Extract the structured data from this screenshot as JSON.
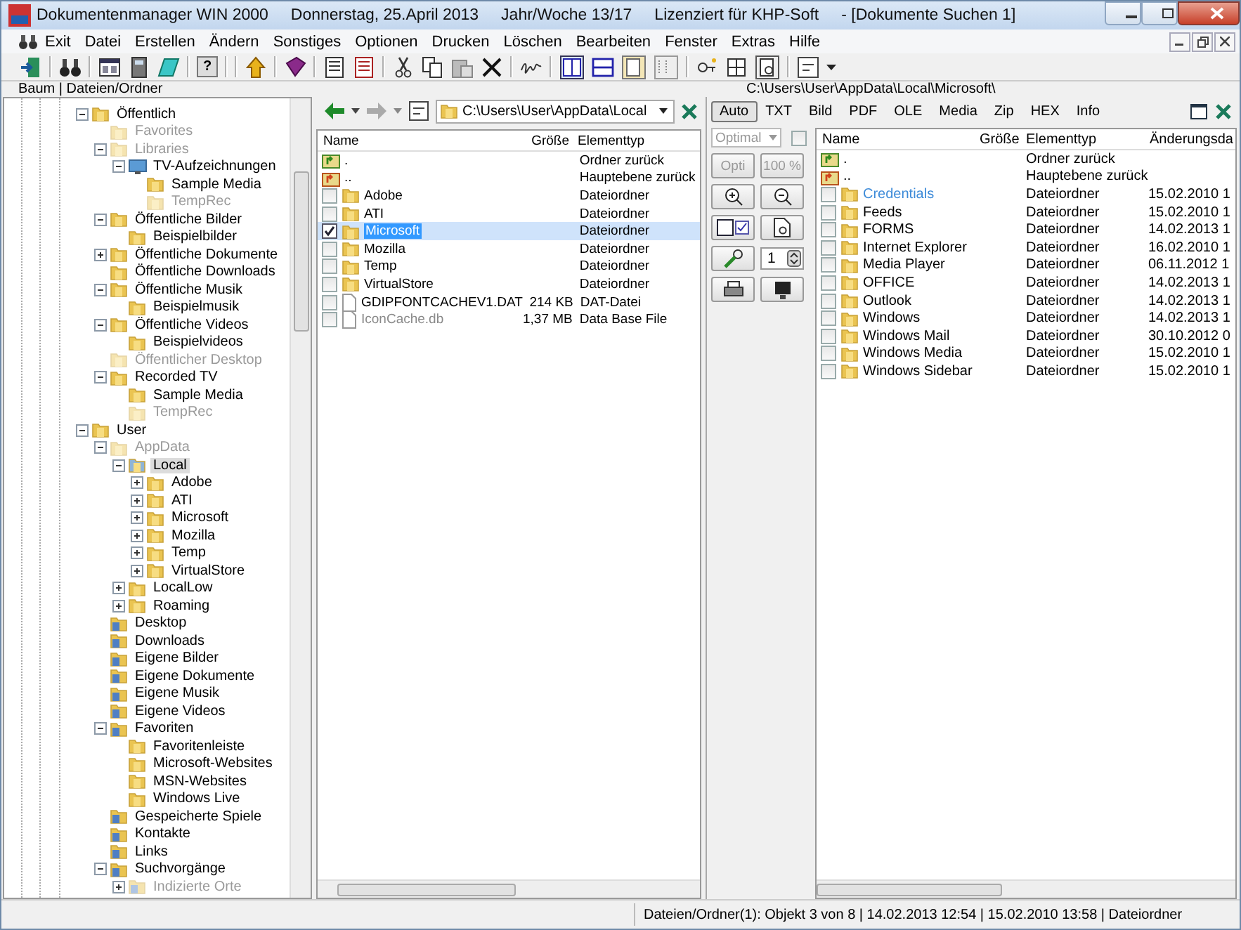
{
  "window": {
    "title_parts": [
      "Dokumentenmanager WIN 2000",
      "Donnerstag, 25.April 2013",
      "Jahr/Woche 13/17",
      "Lizenziert für KHP-Soft",
      "- [Dokumente Suchen 1]"
    ]
  },
  "menu": [
    "Exit",
    "Datei",
    "Erstellen",
    "Ändern",
    "Sonstiges",
    "Optionen",
    "Drucken",
    "Löschen",
    "Bearbeiten",
    "Fenster",
    "Extras",
    "Hilfe"
  ],
  "toolbar": {
    "help_label": "?"
  },
  "panel_label": "Baum | Dateien/Ordner",
  "tree": [
    {
      "label": "Öffentlich",
      "kind": "folder",
      "expanded": true,
      "dimmed": false,
      "selected": false,
      "children": [
        {
          "label": "Favorites",
          "kind": "folder",
          "dimmed": true,
          "selected": false
        },
        {
          "label": "Libraries",
          "kind": "folder",
          "expanded": true,
          "dimmed": true,
          "selected": false,
          "children": [
            {
              "label": "TV-Aufzeichnungen",
              "kind": "screen",
              "expanded": true,
              "dimmed": false,
              "selected": false,
              "children": [
                {
                  "label": "Sample Media",
                  "kind": "folder",
                  "dimmed": false,
                  "selected": false
                },
                {
                  "label": "TempRec",
                  "kind": "folder",
                  "dimmed": true,
                  "selected": false
                }
              ]
            }
          ]
        },
        {
          "label": "Öffentliche Bilder",
          "kind": "folder",
          "expanded": true,
          "dimmed": false,
          "selected": false,
          "children": [
            {
              "label": "Beispielbilder",
              "kind": "folder",
              "dimmed": false,
              "selected": false
            }
          ]
        },
        {
          "label": "Öffentliche Dokumente",
          "kind": "folder",
          "expanded": false,
          "dimmed": false,
          "selected": false
        },
        {
          "label": "Öffentliche Downloads",
          "kind": "folder",
          "dimmed": false,
          "selected": false
        },
        {
          "label": "Öffentliche Musik",
          "kind": "folder",
          "expanded": true,
          "dimmed": false,
          "selected": false,
          "children": [
            {
              "label": "Beispielmusik",
              "kind": "folder",
              "dimmed": false,
              "selected": false
            }
          ]
        },
        {
          "label": "Öffentliche Videos",
          "kind": "folder",
          "expanded": true,
          "dimmed": false,
          "selected": false,
          "children": [
            {
              "label": "Beispielvideos",
              "kind": "folder",
              "dimmed": false,
              "selected": false
            }
          ]
        },
        {
          "label": "Öffentlicher Desktop",
          "kind": "folder",
          "dimmed": true,
          "selected": false
        },
        {
          "label": "Recorded TV",
          "kind": "folder",
          "expanded": true,
          "dimmed": false,
          "selected": false,
          "children": [
            {
              "label": "Sample Media",
              "kind": "folder",
              "dimmed": false,
              "selected": false
            },
            {
              "label": "TempRec",
              "kind": "folder",
              "dimmed": true,
              "selected": false
            }
          ]
        }
      ]
    },
    {
      "label": "User",
      "kind": "folder",
      "expanded": true,
      "dimmed": false,
      "selected": false,
      "children": [
        {
          "label": "AppData",
          "kind": "folder",
          "expanded": true,
          "dimmed": true,
          "selected": false,
          "children": [
            {
              "label": "Local",
              "kind": "folder",
              "expanded": true,
              "dimmed": false,
              "selected": true,
              "children": [
                {
                  "label": "Adobe",
                  "kind": "folder",
                  "expanded": false,
                  "dimmed": false,
                  "selected": false
                },
                {
                  "label": "ATI",
                  "kind": "folder",
                  "expanded": false,
                  "dimmed": false,
                  "selected": false
                },
                {
                  "label": "Microsoft",
                  "kind": "folder",
                  "expanded": false,
                  "dimmed": false,
                  "selected": false
                },
                {
                  "label": "Mozilla",
                  "kind": "folder",
                  "expanded": false,
                  "dimmed": false,
                  "selected": false
                },
                {
                  "label": "Temp",
                  "kind": "folder",
                  "expanded": false,
                  "dimmed": false,
                  "selected": false
                },
                {
                  "label": "VirtualStore",
                  "kind": "folder",
                  "expanded": false,
                  "dimmed": false,
                  "selected": false
                }
              ]
            },
            {
              "label": "LocalLow",
              "kind": "folder",
              "expanded": false,
              "dimmed": false,
              "selected": false
            },
            {
              "label": "Roaming",
              "kind": "folder",
              "expanded": false,
              "dimmed": false,
              "selected": false
            }
          ]
        },
        {
          "label": "Desktop",
          "kind": "special",
          "dimmed": false,
          "selected": false
        },
        {
          "label": "Downloads",
          "kind": "special",
          "dimmed": false,
          "selected": false
        },
        {
          "label": "Eigene Bilder",
          "kind": "special",
          "dimmed": false,
          "selected": false
        },
        {
          "label": "Eigene Dokumente",
          "kind": "special",
          "dimmed": false,
          "selected": false
        },
        {
          "label": "Eigene Musik",
          "kind": "special",
          "dimmed": false,
          "selected": false
        },
        {
          "label": "Eigene Videos",
          "kind": "special",
          "dimmed": false,
          "selected": false
        },
        {
          "label": "Favoriten",
          "kind": "special",
          "expanded": true,
          "dimmed": false,
          "selected": false,
          "children": [
            {
              "label": "Favoritenleiste",
              "kind": "folder",
              "dimmed": false,
              "selected": false
            },
            {
              "label": "Microsoft-Websites",
              "kind": "folder",
              "dimmed": false,
              "selected": false
            },
            {
              "label": "MSN-Websites",
              "kind": "folder",
              "dimmed": false,
              "selected": false
            },
            {
              "label": "Windows Live",
              "kind": "folder",
              "dimmed": false,
              "selected": false
            }
          ]
        },
        {
          "label": "Gespeicherte Spiele",
          "kind": "special",
          "dimmed": false,
          "selected": false
        },
        {
          "label": "Kontakte",
          "kind": "special",
          "dimmed": false,
          "selected": false
        },
        {
          "label": "Links",
          "kind": "special",
          "dimmed": false,
          "selected": false
        },
        {
          "label": "Suchvorgänge",
          "kind": "special",
          "expanded": true,
          "dimmed": false,
          "selected": false,
          "children": [
            {
              "label": "Indizierte Orte",
              "kind": "special",
              "expanded": false,
              "dimmed": true,
              "selected": false
            }
          ]
        }
      ]
    }
  ],
  "file_list": {
    "path": "C:\\Users\\User\\AppData\\Local",
    "columns": [
      "Name",
      "Größe",
      "Elementtyp"
    ],
    "rows": [
      {
        "kind": "up",
        "name": ".",
        "type": "Ordner zurück",
        "selected": false
      },
      {
        "kind": "top",
        "name": "..",
        "type": "Hauptebene zurück",
        "selected": false
      },
      {
        "kind": "folder",
        "name": "Adobe",
        "type": "Dateiordner",
        "checked": false,
        "selected": false,
        "dimmed": false
      },
      {
        "kind": "folder",
        "name": "ATI",
        "type": "Dateiordner",
        "checked": false,
        "selected": false,
        "dimmed": false
      },
      {
        "kind": "folder",
        "name": "Microsoft",
        "type": "Dateiordner",
        "checked": true,
        "selected": true,
        "dimmed": false
      },
      {
        "kind": "folder",
        "name": "Mozilla",
        "type": "Dateiordner",
        "checked": false,
        "selected": false,
        "dimmed": false
      },
      {
        "kind": "folder",
        "name": "Temp",
        "type": "Dateiordner",
        "checked": false,
        "selected": false,
        "dimmed": false
      },
      {
        "kind": "folder",
        "name": "VirtualStore",
        "type": "Dateiordner",
        "checked": false,
        "selected": false,
        "dimmed": false
      },
      {
        "kind": "file",
        "name": "GDIPFONTCACHEV1.DAT",
        "size": "214 KB",
        "type": "DAT-Datei",
        "checked": false,
        "selected": false,
        "dimmed": false
      },
      {
        "kind": "file",
        "name": "IconCache.db",
        "size": "1,37 MB",
        "type": "Data Base File",
        "checked": false,
        "selected": false,
        "dimmed": true
      }
    ]
  },
  "preview": {
    "path": "C:\\Users\\User\\AppData\\Local\\Microsoft\\",
    "tabs": [
      {
        "label": "Auto",
        "selected": true
      },
      {
        "label": "TXT",
        "selected": false
      },
      {
        "label": "Bild",
        "selected": false
      },
      {
        "label": "PDF",
        "selected": false
      },
      {
        "label": "OLE",
        "selected": false
      },
      {
        "label": "Media",
        "selected": false
      },
      {
        "label": "Zip",
        "selected": false
      },
      {
        "label": "HEX",
        "selected": false
      },
      {
        "label": "Info",
        "selected": false
      }
    ],
    "zoom_mode": {
      "value": "Optimal",
      "disabled": true
    },
    "fit_checked": false,
    "opti_label": "Opti",
    "zoom_label": "100 %",
    "page": "1",
    "columns": [
      "Name",
      "Größe",
      "Elementtyp",
      "Änderungsda"
    ],
    "rows": [
      {
        "kind": "up",
        "name": ".",
        "type": "Ordner zurück",
        "selected": false
      },
      {
        "kind": "top",
        "name": "..",
        "type": "Hauptebene zurück",
        "selected": false
      },
      {
        "kind": "folder",
        "name": "Credentials",
        "type": "Dateiordner",
        "date": "15.02.2010 1",
        "checked": false,
        "selected": false,
        "color": "#3c8ad8"
      },
      {
        "kind": "folder",
        "name": "Feeds",
        "type": "Dateiordner",
        "date": "15.02.2010 1",
        "checked": false,
        "selected": false,
        "color": "#000000"
      },
      {
        "kind": "folder",
        "name": "FORMS",
        "type": "Dateiordner",
        "date": "14.02.2013 1",
        "checked": false,
        "selected": false,
        "color": "#000000"
      },
      {
        "kind": "folder",
        "name": "Internet Explorer",
        "type": "Dateiordner",
        "date": "16.02.2010 1",
        "checked": false,
        "selected": false,
        "color": "#000000"
      },
      {
        "kind": "folder",
        "name": "Media Player",
        "type": "Dateiordner",
        "date": "06.11.2012 1",
        "checked": false,
        "selected": false,
        "color": "#000000"
      },
      {
        "kind": "folder",
        "name": "OFFICE",
        "type": "Dateiordner",
        "date": "14.02.2013 1",
        "checked": false,
        "selected": false,
        "color": "#000000"
      },
      {
        "kind": "folder",
        "name": "Outlook",
        "type": "Dateiordner",
        "date": "14.02.2013 1",
        "checked": false,
        "selected": false,
        "color": "#000000"
      },
      {
        "kind": "folder",
        "name": "Windows",
        "type": "Dateiordner",
        "date": "14.02.2013 1",
        "checked": false,
        "selected": false,
        "color": "#000000"
      },
      {
        "kind": "folder",
        "name": "Windows Mail",
        "type": "Dateiordner",
        "date": "30.10.2012 0",
        "checked": false,
        "selected": false,
        "color": "#000000"
      },
      {
        "kind": "folder",
        "name": "Windows Media",
        "type": "Dateiordner",
        "date": "15.02.2010 1",
        "checked": false,
        "selected": false,
        "color": "#000000"
      },
      {
        "kind": "folder",
        "name": "Windows Sidebar",
        "type": "Dateiordner",
        "date": "15.02.2010 1",
        "checked": false,
        "selected": false,
        "color": "#000000"
      }
    ]
  },
  "status_bar": "Dateien/Ordner(1): Objekt 3 von 8 | 14.02.2013 12:54 | 15.02.2010 13:58 | Dateiordner"
}
